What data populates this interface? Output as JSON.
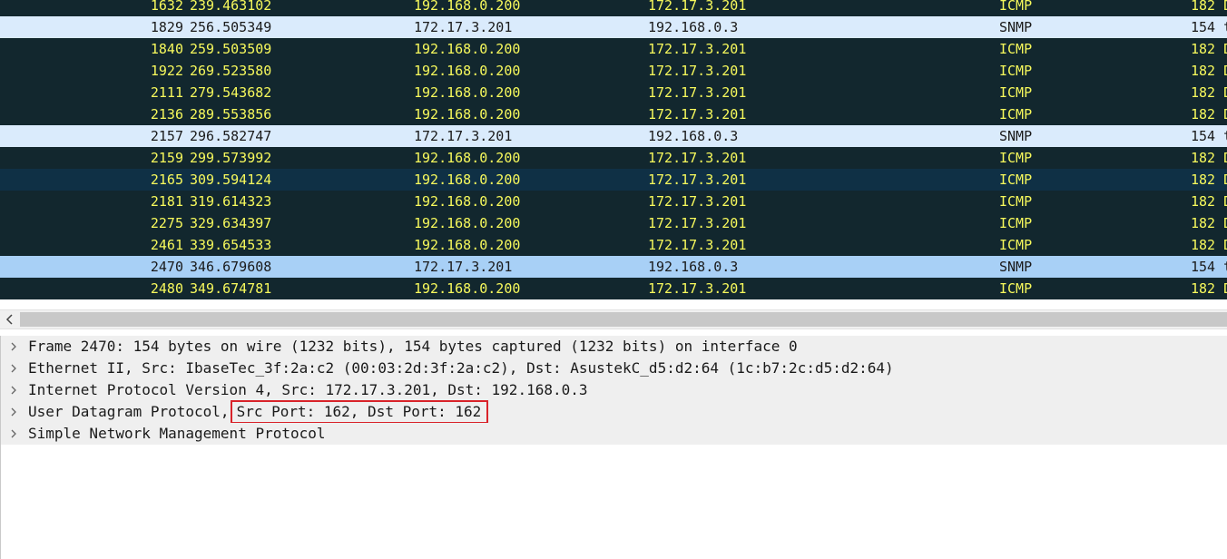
{
  "packets": [
    {
      "no": "1632",
      "time": "239.463102",
      "src": "192.168.0.200",
      "dst": "172.17.3.201",
      "proto": "ICMP",
      "len": "182 D",
      "kind": "icmp"
    },
    {
      "no": "1829",
      "time": "256.505349",
      "src": "172.17.3.201",
      "dst": "192.168.0.3",
      "proto": "SNMP",
      "len": "154 t",
      "kind": "snmp"
    },
    {
      "no": "1840",
      "time": "259.503509",
      "src": "192.168.0.200",
      "dst": "172.17.3.201",
      "proto": "ICMP",
      "len": "182 D",
      "kind": "icmp"
    },
    {
      "no": "1922",
      "time": "269.523580",
      "src": "192.168.0.200",
      "dst": "172.17.3.201",
      "proto": "ICMP",
      "len": "182 D",
      "kind": "icmp"
    },
    {
      "no": "2111",
      "time": "279.543682",
      "src": "192.168.0.200",
      "dst": "172.17.3.201",
      "proto": "ICMP",
      "len": "182 D",
      "kind": "icmp"
    },
    {
      "no": "2136",
      "time": "289.553856",
      "src": "192.168.0.200",
      "dst": "172.17.3.201",
      "proto": "ICMP",
      "len": "182 D",
      "kind": "icmp"
    },
    {
      "no": "2157",
      "time": "296.582747",
      "src": "172.17.3.201",
      "dst": "192.168.0.3",
      "proto": "SNMP",
      "len": "154 t",
      "kind": "snmp"
    },
    {
      "no": "2159",
      "time": "299.573992",
      "src": "192.168.0.200",
      "dst": "172.17.3.201",
      "proto": "ICMP",
      "len": "182 D",
      "kind": "icmp"
    },
    {
      "no": "2165",
      "time": "309.594124",
      "src": "192.168.0.200",
      "dst": "172.17.3.201",
      "proto": "ICMP",
      "len": "182 D",
      "kind": "icmp hover"
    },
    {
      "no": "2181",
      "time": "319.614323",
      "src": "192.168.0.200",
      "dst": "172.17.3.201",
      "proto": "ICMP",
      "len": "182 D",
      "kind": "icmp"
    },
    {
      "no": "2275",
      "time": "329.634397",
      "src": "192.168.0.200",
      "dst": "172.17.3.201",
      "proto": "ICMP",
      "len": "182 D",
      "kind": "icmp"
    },
    {
      "no": "2461",
      "time": "339.654533",
      "src": "192.168.0.200",
      "dst": "172.17.3.201",
      "proto": "ICMP",
      "len": "182 D",
      "kind": "icmp"
    },
    {
      "no": "2470",
      "time": "346.679608",
      "src": "172.17.3.201",
      "dst": "192.168.0.3",
      "proto": "SNMP",
      "len": "154 t",
      "kind": "snmp selected"
    },
    {
      "no": "2480",
      "time": "349.674781",
      "src": "192.168.0.200",
      "dst": "172.17.3.201",
      "proto": "ICMP",
      "len": "182 D",
      "kind": "icmp"
    }
  ],
  "scrollbar": {
    "left_arrow_icon": "chevron-left-icon"
  },
  "details": [
    {
      "text": "Frame 2470: 154 bytes on wire (1232 bits), 154 bytes captured (1232 bits) on interface 0"
    },
    {
      "text": "Ethernet II, Src: IbaseTec_3f:2a:c2 (00:03:2d:3f:2a:c2), Dst: AsustekC_d5:d2:64 (1c:b7:2c:d5:d2:64)"
    },
    {
      "text": "Internet Protocol Version 4, Src: 172.17.3.201, Dst: 192.168.0.3"
    },
    {
      "text": "User Datagram Protocol,",
      "highlight": "Src Port: 162, Dst Port: 162"
    },
    {
      "text": "Simple Network Management Protocol"
    }
  ],
  "colors": {
    "icmp_bg": "#12272e",
    "icmp_fg": "#f7f95c",
    "snmp_bg": "#daebfc",
    "selected_bg": "#a8d0f6",
    "highlight_border": "#d9232a"
  }
}
